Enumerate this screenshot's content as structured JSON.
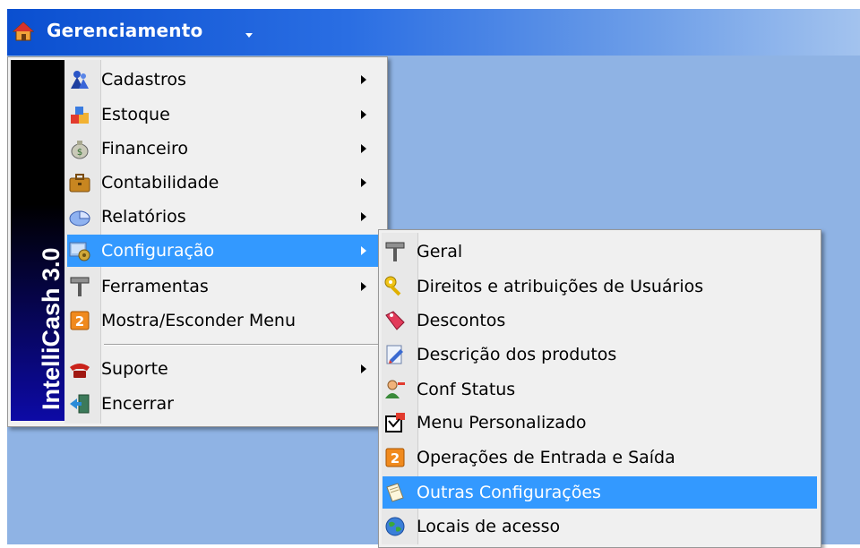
{
  "app": {
    "menu_title": "Gerenciamento",
    "brand": "IntelliCash 3.0"
  },
  "colors": {
    "highlight": "#3399ff",
    "menu_bg": "#f0f0f0",
    "desktop": "#8fb3e4",
    "topbar": "#0a4fd0"
  },
  "main_menu": {
    "items": [
      {
        "label": "Cadastros",
        "icon": "people-icon",
        "submenu": true
      },
      {
        "label": "Estoque",
        "icon": "boxes-icon",
        "submenu": true
      },
      {
        "label": "Financeiro",
        "icon": "money-bag-icon",
        "submenu": true
      },
      {
        "label": "Contabilidade",
        "icon": "briefcase-icon",
        "submenu": true
      },
      {
        "label": "Relatórios",
        "icon": "pie-chart-icon",
        "submenu": true
      },
      {
        "label": "Configuração",
        "icon": "config-icon",
        "submenu": true,
        "highlighted": true
      },
      {
        "label": "Ferramentas",
        "icon": "hammer-icon",
        "submenu": true
      },
      {
        "label": "Mostra/Esconder Menu",
        "icon": "orange-swap-icon",
        "submenu": false
      },
      {
        "label": "Suporte",
        "icon": "phone-icon",
        "submenu": true
      },
      {
        "label": "Encerrar",
        "icon": "exit-door-icon",
        "submenu": false
      }
    ]
  },
  "sub_menu": {
    "items": [
      {
        "label": "Geral",
        "icon": "hammer-icon"
      },
      {
        "label": "Direitos e atribuições de Usuários",
        "icon": "key-icon"
      },
      {
        "label": "Descontos",
        "icon": "tag-icon"
      },
      {
        "label": "Descrição dos produtos",
        "icon": "edit-doc-icon"
      },
      {
        "label": "Conf Status",
        "icon": "user-status-icon"
      },
      {
        "label": "Menu Personalizado",
        "icon": "custom-menu-icon"
      },
      {
        "label": "Operações de Entrada e Saída",
        "icon": "orange-swap-icon"
      },
      {
        "label": "Outras Configurações",
        "icon": "note-icon",
        "highlighted": true
      },
      {
        "label": "Locais de acesso",
        "icon": "globe-icon"
      }
    ]
  }
}
